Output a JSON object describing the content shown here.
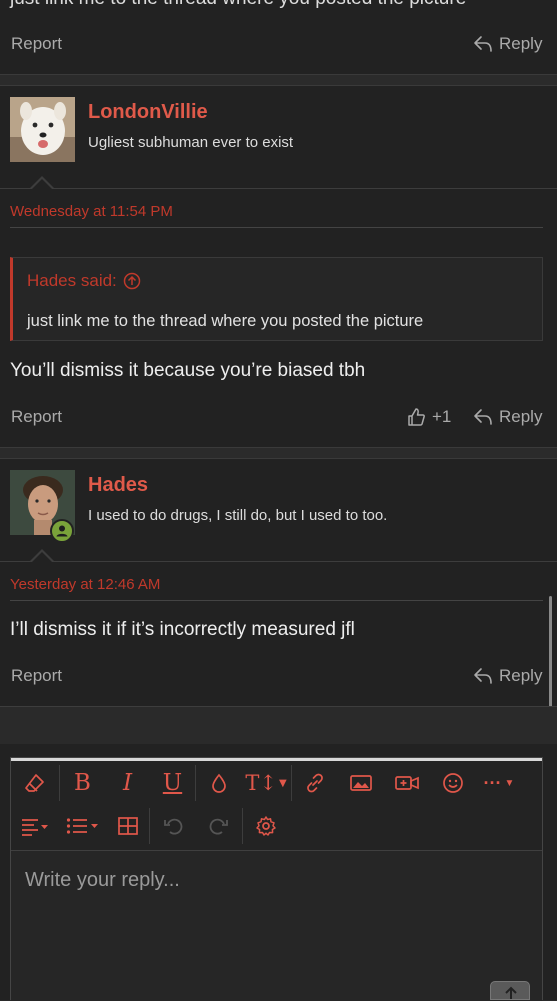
{
  "top_post": {
    "cutoff_text": "just link me to the thread where you posted the picture",
    "report": "Report",
    "reply": "Reply"
  },
  "post1": {
    "username": "LondonVillie",
    "user_title": "Ugliest subhuman ever to exist",
    "date": "Wednesday at 11:54 PM",
    "quote": {
      "author_said": "Hades said:",
      "text": "just link me to the thread where you posted the picture"
    },
    "body": "You’ll dismiss it because you’re biased tbh",
    "report": "Report",
    "reaction_count": "+1",
    "reply": "Reply"
  },
  "post2": {
    "username": "Hades",
    "user_title": "I used to do drugs, I still do, but I used to too.",
    "date": "Yesterday at 12:46 AM",
    "body": "I’ll dismiss it if it’s incorrectly measured jfl",
    "report": "Report",
    "reply": "Reply"
  },
  "editor": {
    "placeholder": "Write your reply...",
    "toolbar_row1": [
      "eraser-icon",
      "bold-icon",
      "italic-icon",
      "underline-icon",
      "text-color-icon",
      "font-size-icon",
      "link-icon",
      "image-icon",
      "media-icon",
      "smilie-icon",
      "more-icon"
    ],
    "toolbar_row2": [
      "align-icon",
      "list-icon",
      "table-icon",
      "undo-icon",
      "redo-icon",
      "settings-icon"
    ],
    "bold_glyph": "B",
    "italic_glyph": "I",
    "underline_glyph": "U",
    "font_size_glyph": "T↕",
    "more_glyph": "···"
  },
  "colors": {
    "accent": "#e0574a",
    "date": "#c0392b",
    "background": "#222222"
  }
}
